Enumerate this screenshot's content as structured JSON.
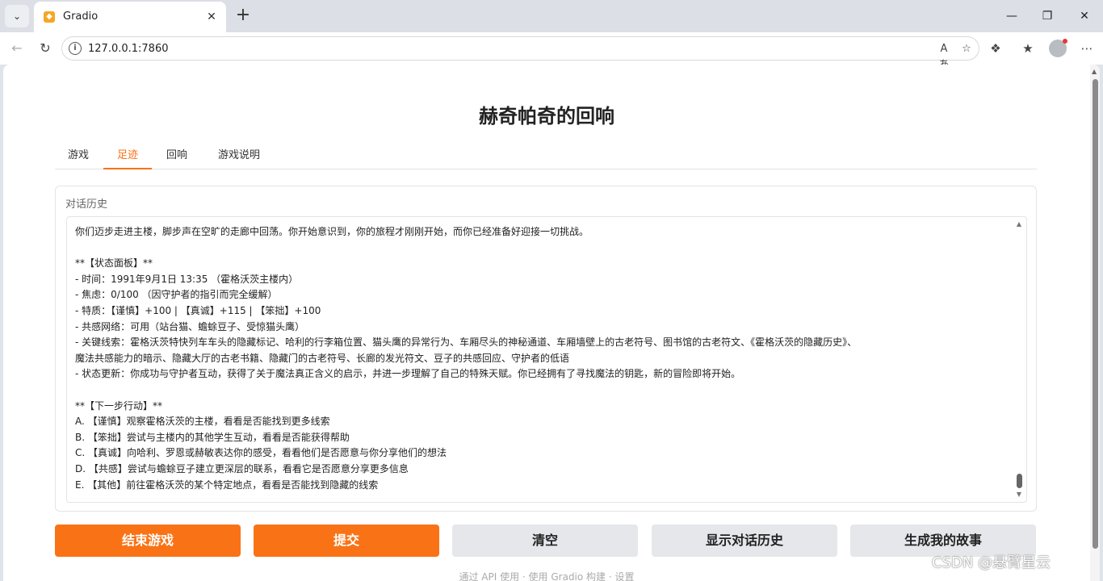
{
  "browser": {
    "tab_title": "Gradio",
    "url": "127.0.0.1:7860"
  },
  "app": {
    "title": "赫奇帕奇的回响",
    "tabs": [
      "游戏",
      "足迹",
      "回响",
      "游戏说明"
    ],
    "active_tab": "足迹",
    "history_label": "对话历史",
    "history_lines": [
      "你们迈步走进主楼，脚步声在空旷的走廊中回荡。你开始意识到，你的旅程才刚刚开始，而你已经准备好迎接一切挑战。",
      "",
      "**【状态面板】**",
      "- 时间：1991年9月1日 13:35 （霍格沃茨主楼内）",
      "- 焦虑：0/100 （因守护者的指引而完全缓解）",
      "- 特质：【谨慎】+100 | 【真诚】+115 | 【笨拙】+100",
      "- 共感网络：可用（站台猫、蟾蜍豆子、受惊猫头鹰）",
      "- 关键线索：霍格沃茨特快列车车头的隐藏标记、哈利的行李箱位置、猫头鹰的异常行为、车厢尽头的神秘通道、车厢墙壁上的古老符号、图书馆的古老符文、《霍格沃茨的隐藏历史》、",
      "魔法共感能力的暗示、隐藏大厅的古老书籍、隐藏门的古老符号、长廊的发光符文、豆子的共感回应、守护者的低语",
      "- 状态更新：你成功与守护者互动，获得了关于魔法真正含义的启示，并进一步理解了自己的特殊天赋。你已经拥有了寻找魔法的钥匙，新的冒险即将开始。",
      "",
      "**【下一步行动】**",
      "A. 【谨慎】观察霍格沃茨的主楼，看看是否能找到更多线索",
      "B. 【笨拙】尝试与主楼内的其他学生互动，看看是否能获得帮助",
      "C. 【真诚】向哈利、罗恩或赫敏表达你的感受，看看他们是否愿意与你分享他们的想法",
      "D. 【共感】尝试与蟾蜍豆子建立更深层的联系，看看它是否愿意分享更多信息",
      "E. 【其他】前往霍格沃茨的某个特定地点，看看是否能找到隐藏的线索"
    ],
    "buttons": {
      "end": "结束游戏",
      "submit": "提交",
      "clear": "清空",
      "show_history": "显示对话历史",
      "generate_story": "生成我的故事"
    },
    "footer": "通过 API 使用 · 使用 Gradio 构建 · 设置"
  },
  "watermark": "CSDN @悬臂星云",
  "colors": {
    "accent": "#f97316",
    "secondary_button": "#e5e7eb"
  }
}
